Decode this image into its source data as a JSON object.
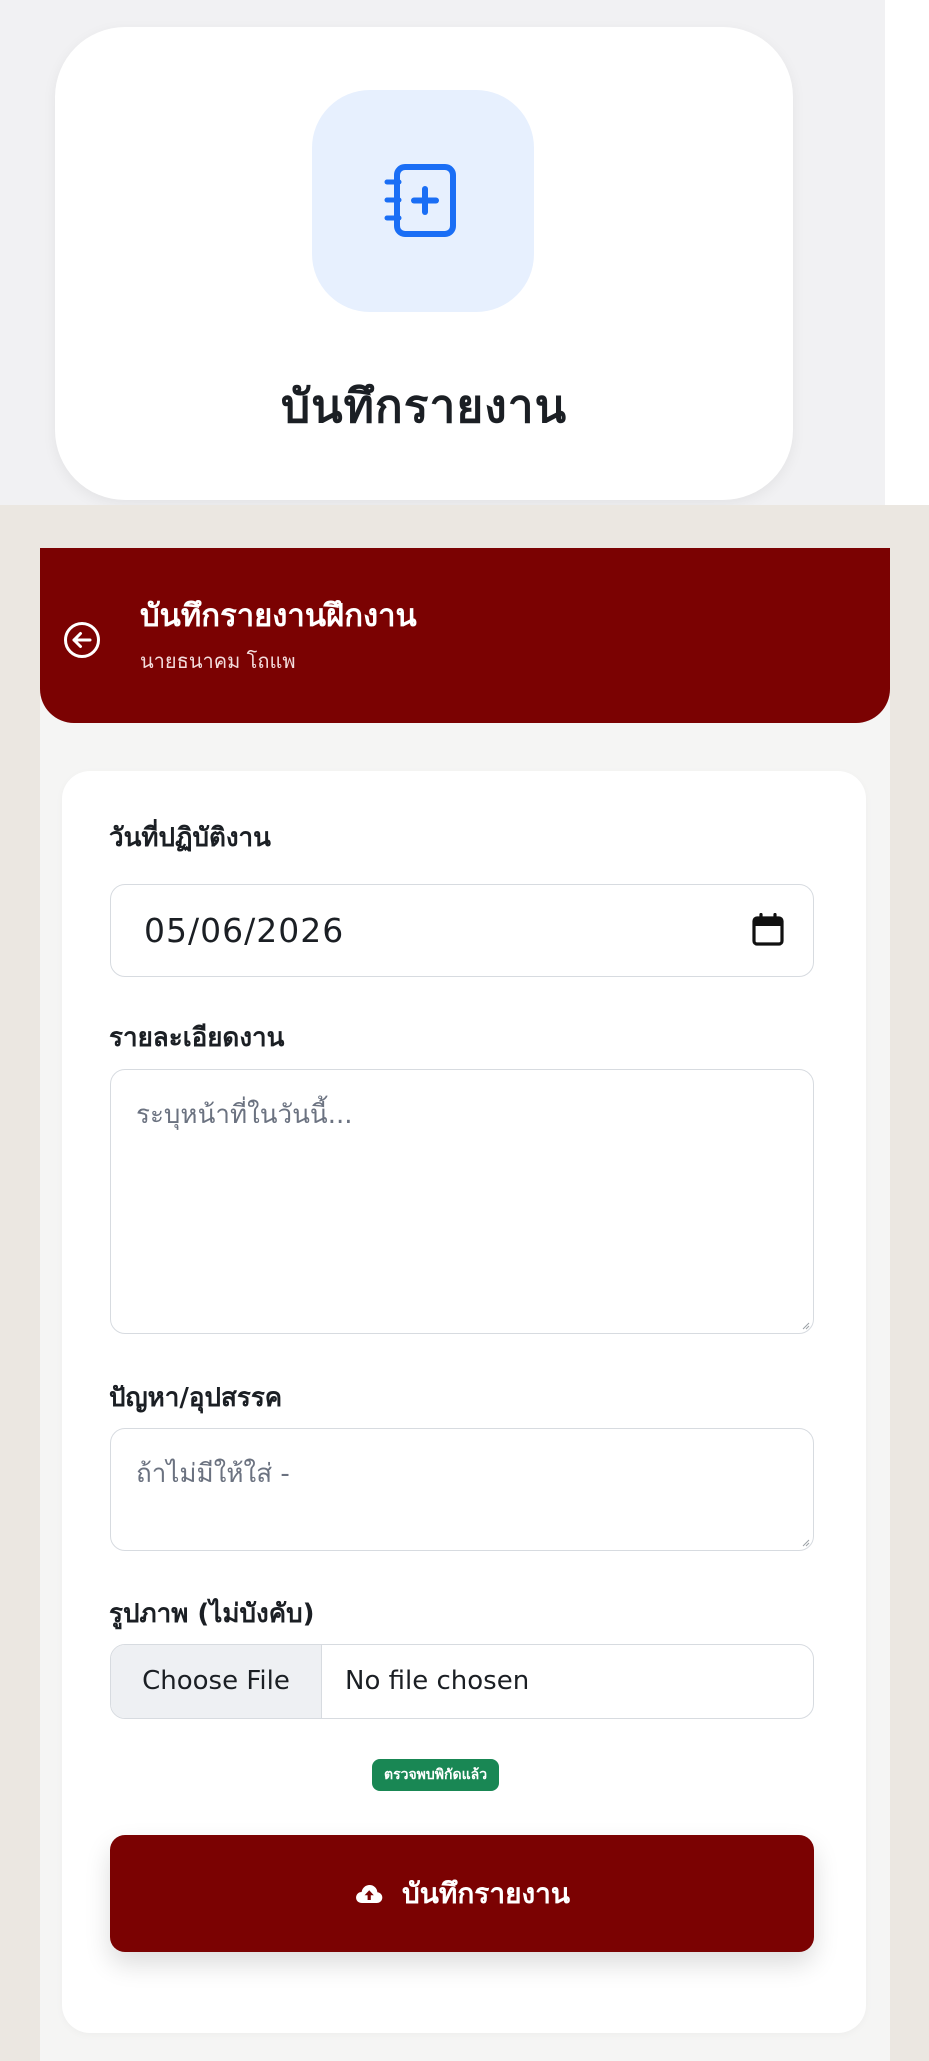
{
  "menu_card": {
    "icon": "notebook-plus-icon",
    "title": "บันทึกรายงาน"
  },
  "header": {
    "back_icon": "arrow-left-circle-icon",
    "title": "บันทึกรายงานฝึกงาน",
    "subtitle": "นายธนาคม โถแพ"
  },
  "form": {
    "date_label": "วันที่ปฏิบัติงาน",
    "date_value": "05/06/2026",
    "details_label": "รายละเอียดงาน",
    "details_placeholder": "ระบุหน้าที่ในวันนี้...",
    "problems_label": "ปัญหา/อุปสรรค",
    "problems_placeholder": "ถ้าไม่มีให้ใส่ -",
    "image_label": "รูปภาพ (ไม่บังคับ)",
    "choose_file": "Choose File",
    "no_file": "No file chosen",
    "location_badge": "ตรวจพบพิกัดแล้ว",
    "submit_label": "บันทึกรายงาน",
    "submit_icon": "cloud-upload-icon"
  },
  "colors": {
    "brand": "#7b0202",
    "badge": "#198754",
    "icon_tile": "#e7f0fe",
    "icon_accent": "#1a6ef5"
  }
}
